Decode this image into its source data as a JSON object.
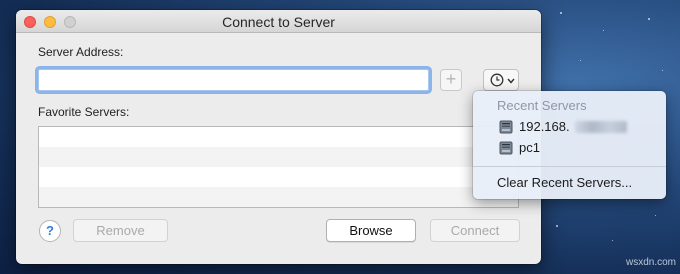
{
  "window": {
    "title": "Connect to Server",
    "server_address_label": "Server Address:",
    "server_address_value": "",
    "add_button_label": "+",
    "favorite_servers_label": "Favorite Servers:",
    "favorite_servers": [],
    "help_label": "?",
    "remove_label": "Remove",
    "browse_label": "Browse",
    "connect_label": "Connect"
  },
  "recent_menu": {
    "header": "Recent Servers",
    "items": [
      {
        "label": "192.168.",
        "icon": "server-drive-icon"
      },
      {
        "label": "pc1",
        "icon": "server-drive-icon"
      }
    ],
    "clear_label": "Clear Recent Servers..."
  },
  "watermark": "wsxdn.com",
  "colors": {
    "close": "#fc605c",
    "minimize": "#fdbc40",
    "focus_ring": "#8ab4ea",
    "help_blue": "#2d7fe0",
    "desktop": "#1c3b6a"
  }
}
